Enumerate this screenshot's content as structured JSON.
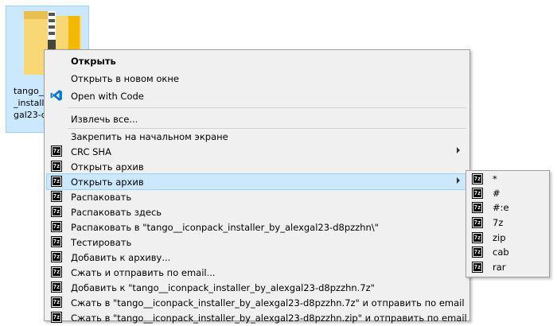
{
  "desktop": {
    "file_name": "tango__\n_installe\ngal23-d"
  },
  "menu": {
    "items": [
      {
        "label": "Открыть",
        "icon": "none"
      },
      {
        "label": "Открыть в новом окне",
        "icon": "none"
      },
      {
        "label": "Open with Code",
        "icon": "vscode-icon"
      },
      {
        "label": "Извлечь все...",
        "icon": "none"
      },
      {
        "label": "Закрепить на начальном экране",
        "icon": "none"
      },
      {
        "label": "CRC SHA",
        "icon": "7zip-icon"
      },
      {
        "label": "Открыть архив",
        "icon": "7zip-icon"
      },
      {
        "label": "Открыть архив",
        "icon": "7zip-icon"
      },
      {
        "label": "Распаковать",
        "icon": "7zip-icon"
      },
      {
        "label": "Распаковать здесь",
        "icon": "7zip-icon"
      },
      {
        "label": "Распаковать в \"tango__iconpack_installer_by_alexgal23-d8pzzhn\\\"",
        "icon": "7zip-icon"
      },
      {
        "label": "Тестировать",
        "icon": "7zip-icon"
      },
      {
        "label": "Добавить к архиву...",
        "icon": "7zip-icon"
      },
      {
        "label": "Сжать и отправить по email...",
        "icon": "7zip-icon"
      },
      {
        "label": "Добавить к \"tango__iconpack_installer_by_alexgal23-d8pzzhn.7z\"",
        "icon": "7zip-icon"
      },
      {
        "label": "Сжать в \"tango__iconpack_installer_by_alexgal23-d8pzzhn.7z\" и отправить по email",
        "icon": "7zip-icon"
      },
      {
        "label": "Сжать в \"tango__iconpack_installer_by_alexgal23-d8pzzhn.zip\" и отправить по email",
        "icon": "7zip-icon"
      }
    ]
  },
  "submenu": {
    "items": [
      {
        "label": "*"
      },
      {
        "label": "#"
      },
      {
        "label": "#:e"
      },
      {
        "label": "7z"
      },
      {
        "label": "zip"
      },
      {
        "label": "cab"
      },
      {
        "label": "rar"
      }
    ]
  },
  "icon_text": "7z",
  "colors": {
    "highlight": "#cce8ff",
    "menu_bg": "#f0f0f0",
    "vscode_blue": "#0078d4",
    "folder_yellow": "#f8d775"
  }
}
